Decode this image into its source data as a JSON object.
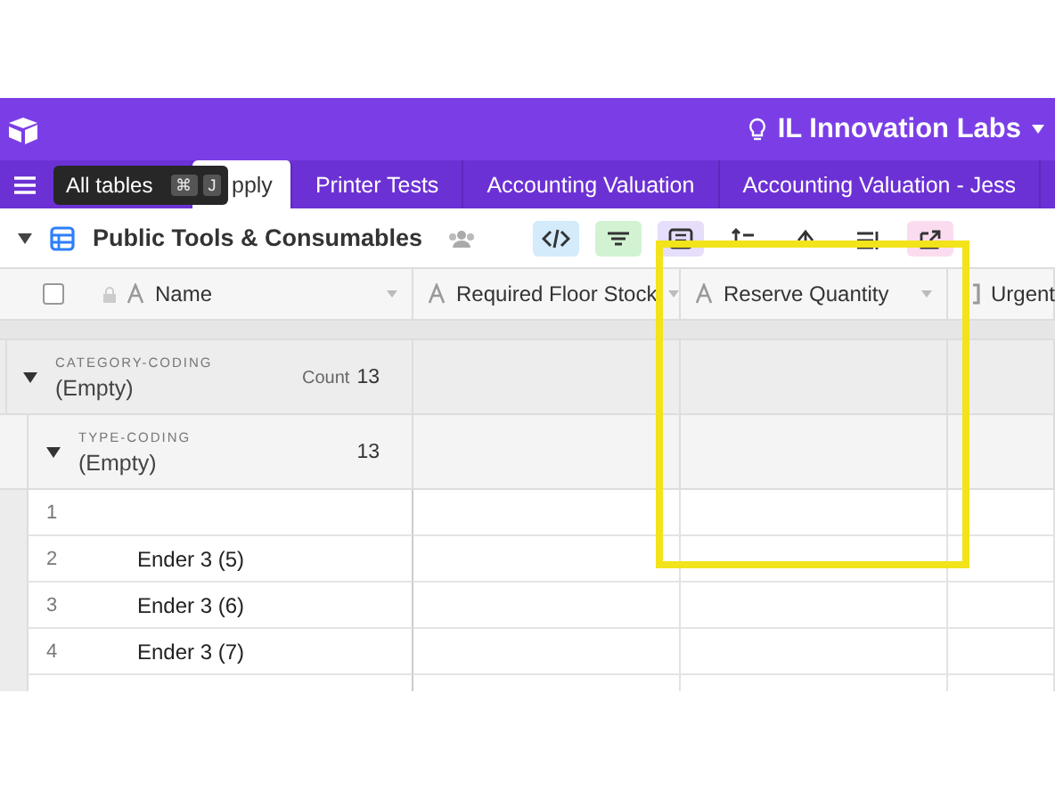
{
  "workspace": {
    "name": "IL Innovation Labs"
  },
  "tabs": [
    {
      "label": "pply",
      "selected": true
    },
    {
      "label": "Printer Tests",
      "selected": false
    },
    {
      "label": "Accounting Valuation",
      "selected": false
    },
    {
      "label": "Accounting Valuation - Jess",
      "selected": false
    }
  ],
  "tooltip": {
    "label": "All tables",
    "keys": [
      "⌘",
      "J"
    ]
  },
  "table_name": "Public Tools & Consumables",
  "view_tools": [
    {
      "kind": "code",
      "color": "#d3ebfa"
    },
    {
      "kind": "filter",
      "color": "#d2f3d2"
    },
    {
      "kind": "group",
      "color": "#e6defa"
    },
    {
      "kind": "sort"
    },
    {
      "kind": "color"
    },
    {
      "kind": "height"
    },
    {
      "kind": "share",
      "color": "#fbdcef"
    }
  ],
  "select_all": {
    "checked": false
  },
  "columns": [
    {
      "label": "Name",
      "kind": "text"
    },
    {
      "label": "Required Floor Stock",
      "kind": "text"
    },
    {
      "label": "Reserve Quantity",
      "kind": "text"
    },
    {
      "label": "Urgent",
      "kind": "formula"
    }
  ],
  "groups": [
    {
      "field": "CATEGORY-CODING",
      "value": "(Empty)",
      "count_label": "Count",
      "count": "13",
      "expanded": true
    },
    {
      "field": "TYPE-CODING",
      "value": "(Empty)",
      "count": "13",
      "expanded": true
    }
  ],
  "rows": [
    {
      "number": "1"
    },
    {
      "number": "2",
      "name": "Ender 3 (5)"
    },
    {
      "number": "3",
      "name": "Ender 3 (6)"
    },
    {
      "number": "4",
      "name": "Ender 3 (7)"
    }
  ],
  "highlight": {
    "kind": "rectangle"
  }
}
